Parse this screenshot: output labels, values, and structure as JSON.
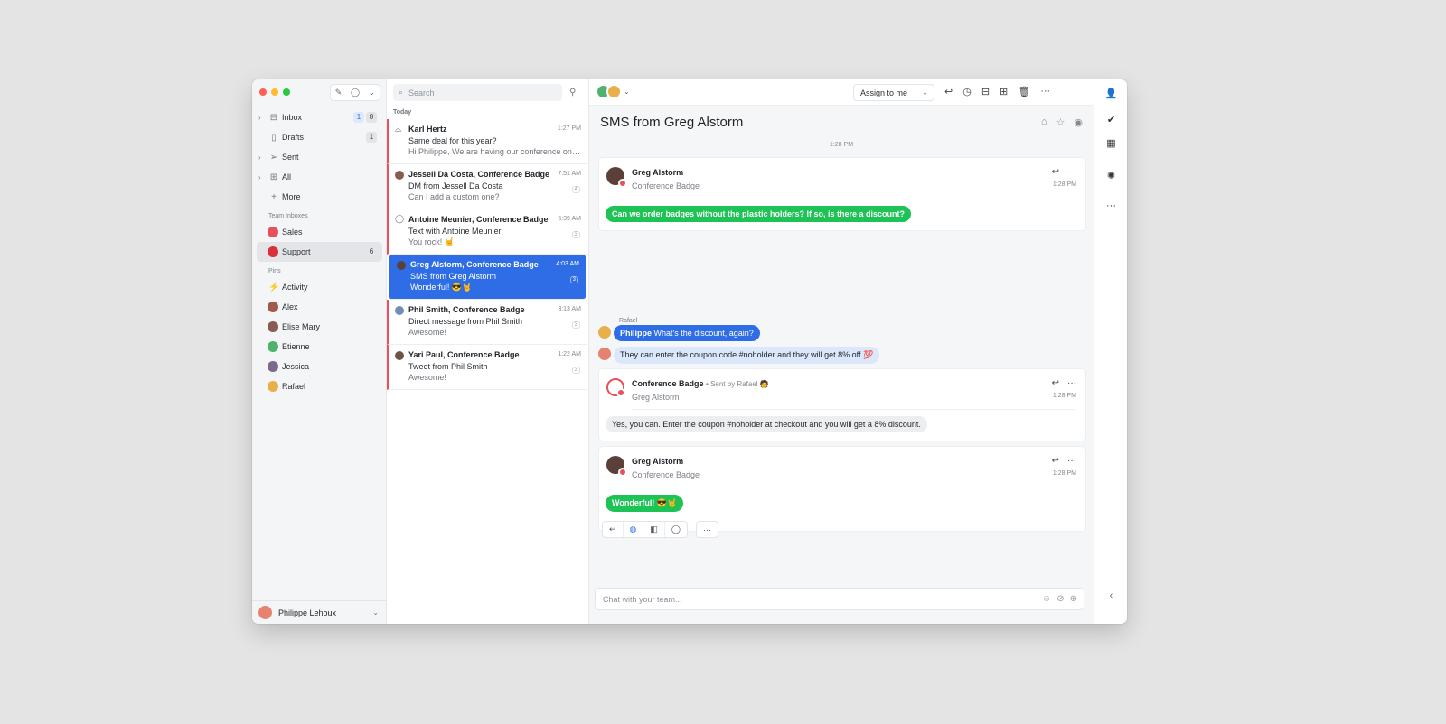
{
  "sidebar": {
    "items": [
      {
        "label": "Inbox",
        "badges": [
          "1",
          "8"
        ],
        "icon": "inbox-icon"
      },
      {
        "label": "Drafts",
        "badges": [
          "1"
        ],
        "icon": "draft-icon"
      },
      {
        "label": "Sent",
        "badges": [],
        "icon": "send-icon"
      },
      {
        "label": "All",
        "badges": [],
        "icon": "archive-icon"
      },
      {
        "label": "More",
        "badges": [],
        "icon": "plus-icon"
      }
    ],
    "team_header": "Team Inboxes",
    "teams": [
      {
        "label": "Sales",
        "count": ""
      },
      {
        "label": "Support",
        "count": "6"
      }
    ],
    "pins_header": "Pins",
    "pins": [
      {
        "label": "Activity"
      },
      {
        "label": "Alex"
      },
      {
        "label": "Elise Mary"
      },
      {
        "label": "Etienne"
      },
      {
        "label": "Jessica"
      },
      {
        "label": "Rafael"
      }
    ],
    "user": "Philippe Lehoux"
  },
  "list": {
    "search_placeholder": "Search",
    "section": "Today",
    "conversations": [
      {
        "name": "Karl Hertz",
        "time": "1:27 PM",
        "subject": "Same deal for this year?",
        "preview": "Hi Philippe, We are having our conference on ...",
        "count": ""
      },
      {
        "name": "Jessell Da Costa, Conference Badge",
        "time": "7:51 AM",
        "subject": "DM from Jessell Da Costa",
        "preview": "Can I add a custom one?",
        "count": "4"
      },
      {
        "name": "Antoine Meunier, Conference Badge",
        "time": "6:39 AM",
        "subject": "Text with Antoine Meunier",
        "preview": "You rock! 🤘",
        "count": "3"
      },
      {
        "name": "Greg Alstorm, Conference Badge",
        "time": "4:03 AM",
        "subject": "SMS from Greg Alstorm",
        "preview": "Wonderful! 😎🤘",
        "count": "3"
      },
      {
        "name": "Phil Smith, Conference Badge",
        "time": "3:13 AM",
        "subject": "Direct message from Phil Smith",
        "preview": "Awesome!",
        "count": "3"
      },
      {
        "name": "Yari Paul, Conference Badge",
        "time": "1:22 AM",
        "subject": "Tweet from Phil Smith",
        "preview": "Awesome!",
        "count": "3"
      }
    ]
  },
  "main": {
    "assign_label": "Assign to me",
    "title": "SMS from Greg Alstorm",
    "timestamp": "1:28 PM",
    "msg1": {
      "from": "Greg Alstorm",
      "to": "Conference Badge",
      "time": "1:28 PM",
      "text": "Can we order badges without the plastic holders? If so, is there a discount?"
    },
    "comment_author": "Rafael",
    "comment1_mention": "Philippe",
    "comment1_text": "What's the discount, again?",
    "comment2_text": "They can enter the coupon code #noholder and they will get 8% off 💯",
    "msg2": {
      "from": "Conference Badge",
      "sent_by": "• Sent by Rafael 🧑",
      "to": "Greg Alstorm",
      "time": "1:28 PM",
      "text": "Yes, you can. Enter the coupon #noholder at checkout and you will get a 8% discount."
    },
    "msg3": {
      "from": "Greg Alstorm",
      "to": "Conference Badge",
      "time": "1:28 PM",
      "text": "Wonderful! 😎🤘"
    },
    "chat_placeholder": "Chat with your team..."
  },
  "colors": {
    "accent": "#2f6de6",
    "sms_green": "#1dc355",
    "alert_red": "#e8505b"
  }
}
